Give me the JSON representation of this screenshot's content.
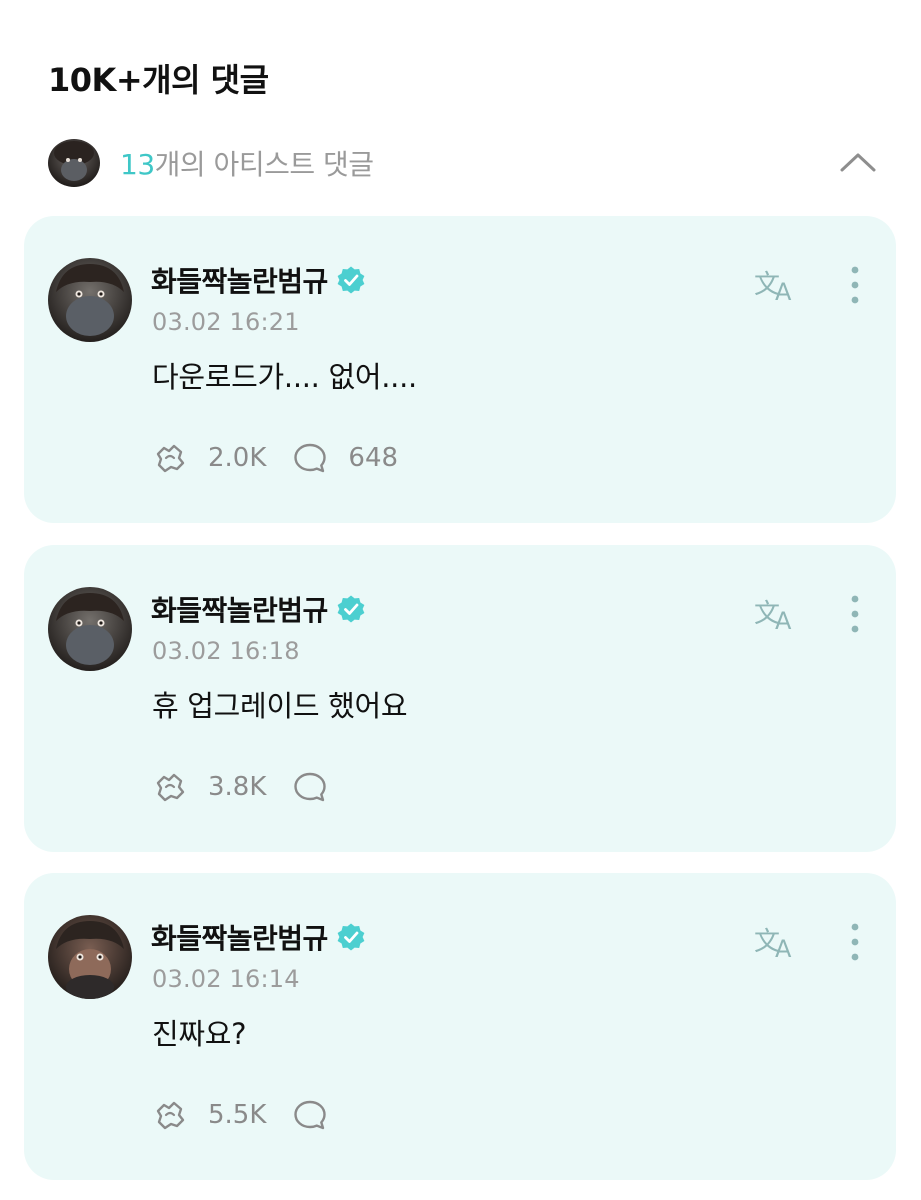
{
  "header": {
    "title": "10K+개의 댓글"
  },
  "artist_summary": {
    "count": "13",
    "label": "개의 아티스트 댓글",
    "avatar_icon": "artist-avatar",
    "collapse_icon": "chevron-up-icon"
  },
  "colors": {
    "accent": "#3fc7c7",
    "card_background": "#ebf9f8",
    "muted_text": "#9a9a9a"
  },
  "comments": [
    {
      "author": "화들짝놀란범규",
      "timestamp": "03.02 16:21",
      "text": "다운로드가.... 없어....",
      "likes": "2.0K",
      "replies": "648"
    },
    {
      "author": "화들짝놀란범규",
      "timestamp": "03.02 16:18",
      "text": "휴 업그레이드 했어요",
      "likes": "3.8K",
      "replies": ""
    },
    {
      "author": "화들짝놀란범규",
      "timestamp": "03.02 16:14",
      "text": "진짜요?",
      "likes": "5.5K",
      "replies": ""
    }
  ],
  "icons": {
    "verified": "verified-badge-icon",
    "translate": "translate-icon",
    "more": "more-vertical-icon",
    "like": "like-icon",
    "reply": "reply-bubble-icon"
  }
}
